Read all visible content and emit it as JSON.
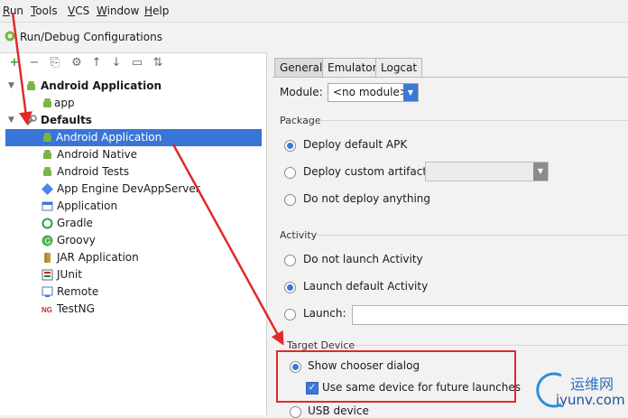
{
  "menu": [
    "Run",
    "Tools",
    "VCS",
    "Window",
    "Help"
  ],
  "window_title": "Run/Debug Configurations",
  "tree": {
    "android_app_group": "Android Application",
    "app": "app",
    "defaults": "Defaults",
    "items": [
      "Android Application",
      "Android Native",
      "Android Tests",
      "App Engine DevAppServer",
      "Application",
      "Gradle",
      "Groovy",
      "JAR Application",
      "JUnit",
      "Remote",
      "TestNG"
    ]
  },
  "tabs": [
    "General",
    "Emulator",
    "Logcat"
  ],
  "module": {
    "label": "Module:",
    "value": "<no module>"
  },
  "package": {
    "title": "Package",
    "options": [
      "Deploy default APK",
      "Deploy custom artifact:",
      "Do not deploy anything"
    ]
  },
  "activity": {
    "title": "Activity",
    "options": [
      "Do not launch Activity",
      "Launch default Activity",
      "Launch:"
    ]
  },
  "target": {
    "title": "Target Device",
    "show_chooser": "Show chooser dialog",
    "same_device": "Use same device for future launches",
    "usb": "USB device"
  },
  "watermark": {
    "brand": "运维网",
    "url": "iyunv.com"
  },
  "colors": {
    "selection": "#3875d7",
    "highlight": "#e02a2a",
    "android": "#7cb342"
  }
}
